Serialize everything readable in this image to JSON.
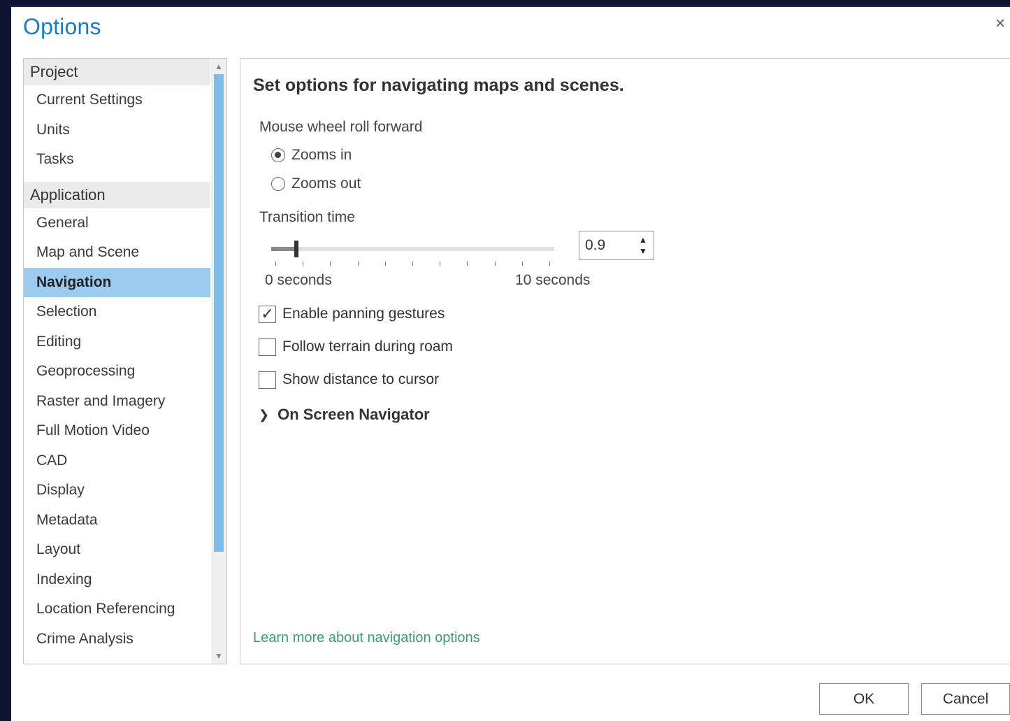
{
  "dialog": {
    "title": "Options",
    "close_glyph": "×"
  },
  "nav": {
    "groups": [
      {
        "header": "Project",
        "items": [
          "Current Settings",
          "Units",
          "Tasks"
        ]
      },
      {
        "header": "Application",
        "items": [
          "General",
          "Map and Scene",
          "Navigation",
          "Selection",
          "Editing",
          "Geoprocessing",
          "Raster and Imagery",
          "Full Motion Video",
          "CAD",
          "Display",
          "Metadata",
          "Layout",
          "Indexing",
          "Location Referencing",
          "Crime Analysis"
        ]
      }
    ],
    "selected": "Navigation",
    "scroll_up_glyph": "▲",
    "scroll_down_glyph": "▼"
  },
  "panel": {
    "heading": "Set options for navigating maps and scenes.",
    "mouse_wheel": {
      "label": "Mouse wheel roll forward",
      "options": [
        "Zooms in",
        "Zooms out"
      ],
      "selected": "Zooms in"
    },
    "transition": {
      "label": "Transition time",
      "value": "0.9",
      "min": 0,
      "max": 10,
      "min_label": "0 seconds",
      "max_label": "10 seconds"
    },
    "checkboxes": [
      {
        "label": "Enable panning gestures",
        "checked": true
      },
      {
        "label": "Follow terrain during roam",
        "checked": false
      },
      {
        "label": "Show distance to cursor",
        "checked": false
      }
    ],
    "expander": {
      "label": "On Screen Navigator",
      "icon": "chevron-right-icon"
    },
    "help_link": "Learn more about navigation options"
  },
  "buttons": {
    "ok": "OK",
    "cancel": "Cancel"
  },
  "colors": {
    "title": "#1e7bc0",
    "selection": "#9dcbf0",
    "scroll_thumb": "#7dbde8",
    "link": "#3f9b6f",
    "backdrop": "#0f1430"
  }
}
